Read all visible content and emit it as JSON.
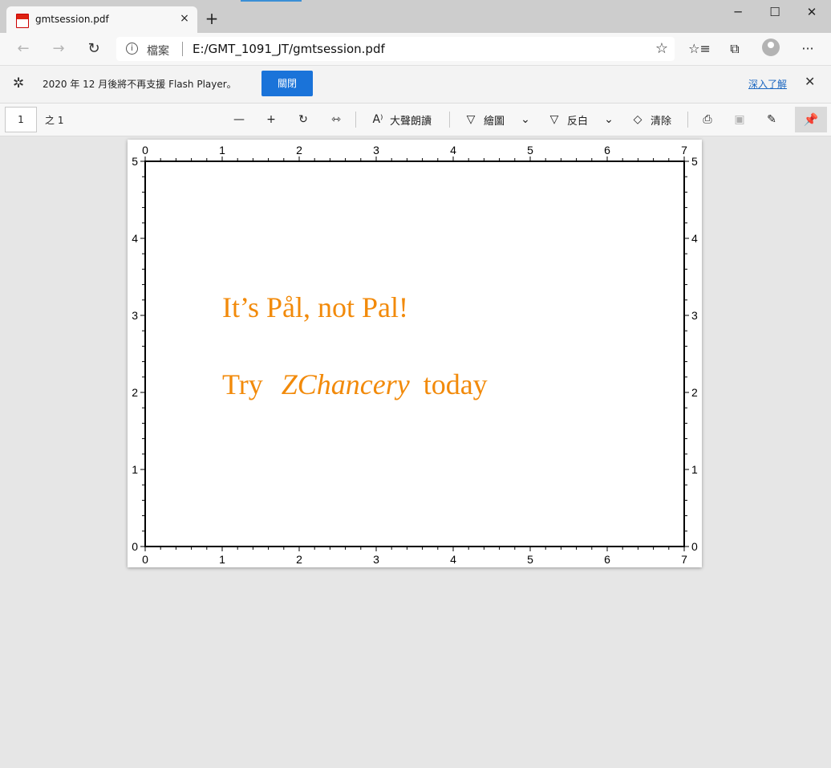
{
  "tab": {
    "title": "gmtsession.pdf",
    "close_glyph": "×",
    "new_tab_glyph": "+"
  },
  "window": {
    "minimize_glyph": "─",
    "maximize_glyph": "☐",
    "close_glyph": "✕"
  },
  "address": {
    "scheme_label": "檔案",
    "url": "E:/GMT_1091_JT/gmtsession.pdf"
  },
  "infobar": {
    "message": "2020 年 12 月後將不再支援 Flash Player。",
    "close_label": "關閉",
    "learn_more": "深入了解"
  },
  "pdf_toolbar": {
    "page_number": "1",
    "page_of": "之 1",
    "read_aloud": "大聲朗讀",
    "draw": "繪圖",
    "highlight": "反白",
    "erase": "清除"
  },
  "plot": {
    "x_ticks": [
      "0",
      "1",
      "2",
      "3",
      "4",
      "5",
      "6",
      "7"
    ],
    "y_ticks": [
      "0",
      "1",
      "2",
      "3",
      "4",
      "5"
    ],
    "xlim": [
      0,
      7
    ],
    "ylim": [
      0,
      5
    ],
    "line1": "It’s Pål, not Pal!",
    "line2_a": "Try",
    "line2_b": "ZChancery",
    "line2_c": "today",
    "text_color": "#f28a0a"
  }
}
